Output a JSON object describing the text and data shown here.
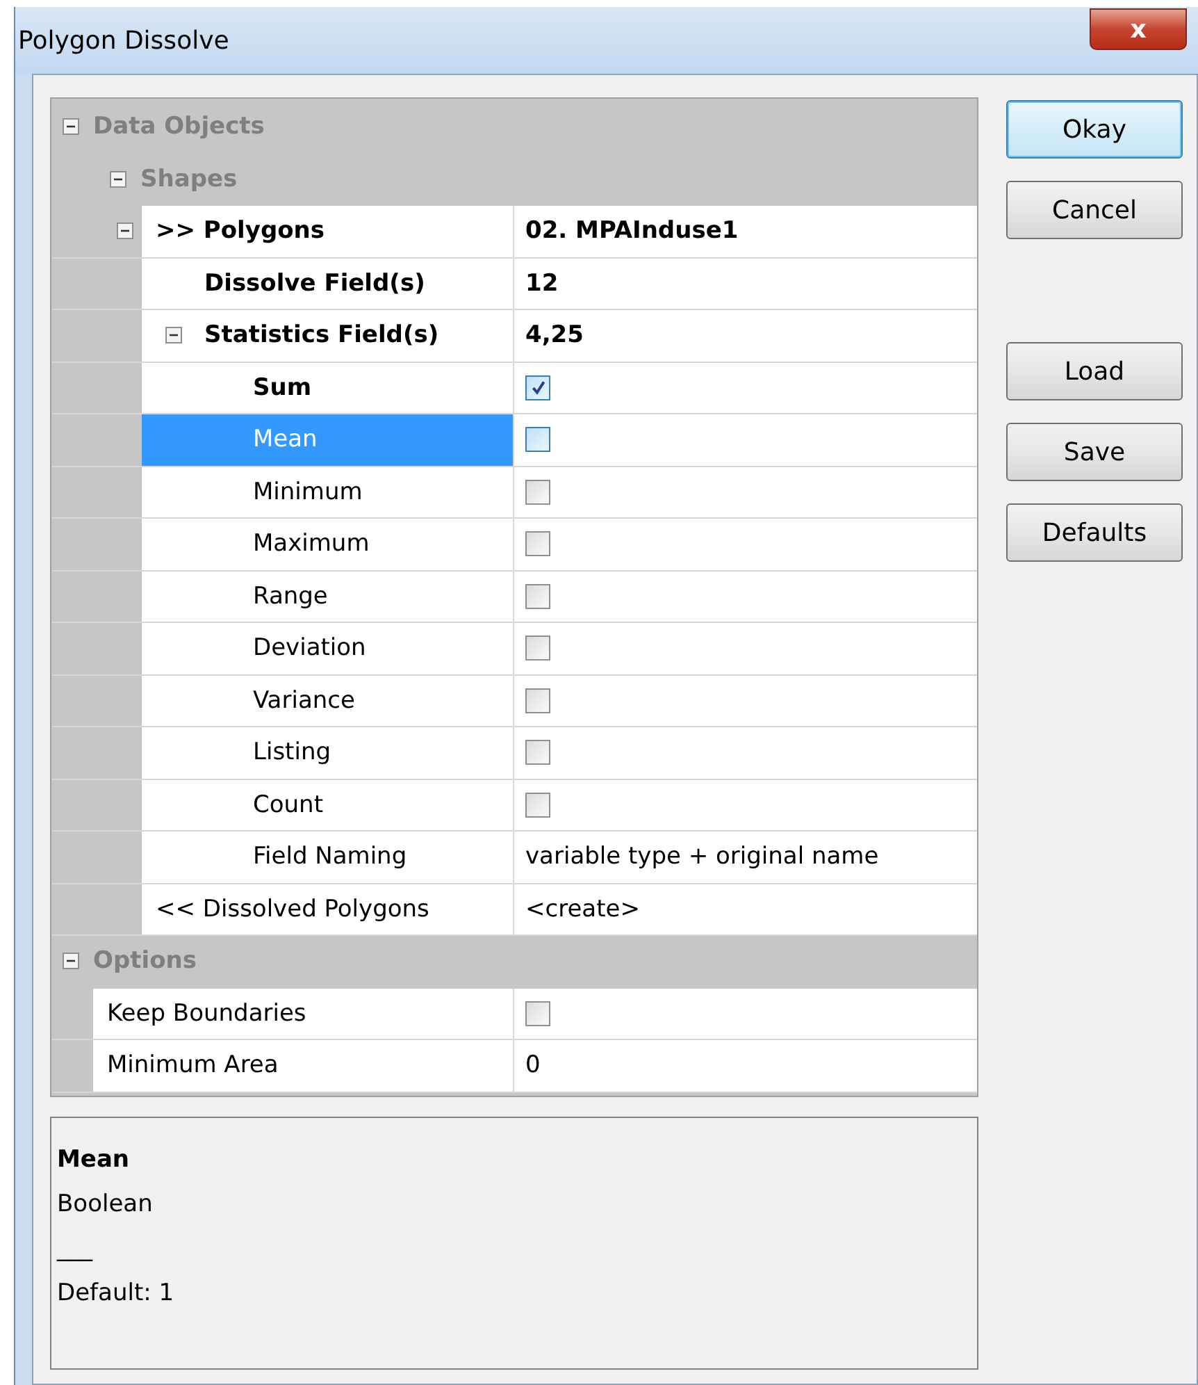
{
  "window": {
    "title": "Polygon Dissolve",
    "close_label": "x"
  },
  "grid": [
    {
      "kind": "category",
      "label": "Data Objects",
      "expanded": true,
      "children": [
        {
          "kind": "category",
          "label": "Shapes",
          "expanded": true,
          "children": [
            {
              "kind": "text",
              "label": ">> Polygons",
              "value": "02. MPAInduse1",
              "modified": true,
              "selected": false,
              "expanded": true,
              "children": [
                {
                  "kind": "text",
                  "label": "Dissolve Field(s)",
                  "value": "12",
                  "modified": true,
                  "selected": false
                },
                {
                  "kind": "text",
                  "label": "Statistics Field(s)",
                  "value": "4,25",
                  "modified": true,
                  "selected": false,
                  "expanded": true,
                  "children": [
                    {
                      "kind": "check",
                      "label": "Sum",
                      "checked": true,
                      "modified": true,
                      "selected": false
                    },
                    {
                      "kind": "check",
                      "label": "Mean",
                      "checked": false,
                      "modified": false,
                      "selected": true
                    },
                    {
                      "kind": "check",
                      "label": "Minimum",
                      "checked": false,
                      "modified": false,
                      "selected": false
                    },
                    {
                      "kind": "check",
                      "label": "Maximum",
                      "checked": false,
                      "modified": false,
                      "selected": false
                    },
                    {
                      "kind": "check",
                      "label": "Range",
                      "checked": false,
                      "modified": false,
                      "selected": false
                    },
                    {
                      "kind": "check",
                      "label": "Deviation",
                      "checked": false,
                      "modified": false,
                      "selected": false
                    },
                    {
                      "kind": "check",
                      "label": "Variance",
                      "checked": false,
                      "modified": false,
                      "selected": false
                    },
                    {
                      "kind": "check",
                      "label": "Listing",
                      "checked": false,
                      "modified": false,
                      "selected": false
                    },
                    {
                      "kind": "check",
                      "label": "Count",
                      "checked": false,
                      "modified": false,
                      "selected": false
                    },
                    {
                      "kind": "text",
                      "label": "Field Naming",
                      "value": "variable type + original name",
                      "modified": false,
                      "selected": false
                    }
                  ]
                }
              ]
            },
            {
              "kind": "text",
              "label": "<< Dissolved Polygons",
              "value": "<create>",
              "modified": false,
              "selected": false
            }
          ]
        }
      ]
    },
    {
      "kind": "category",
      "label": "Options",
      "expanded": true,
      "children": [
        {
          "kind": "check",
          "label": "Keep Boundaries",
          "checked": false,
          "modified": false,
          "selected": false
        },
        {
          "kind": "text",
          "label": "Minimum Area",
          "value": "0",
          "modified": false,
          "selected": false
        }
      ]
    }
  ],
  "description": {
    "title": "Mean",
    "lines": [
      "Boolean",
      "___",
      "Default: 1"
    ]
  },
  "buttons": [
    {
      "label": "Okay",
      "default": true
    },
    {
      "label": "Cancel",
      "default": false
    },
    {
      "label": "Load",
      "default": false
    },
    {
      "label": "Save",
      "default": false
    },
    {
      "label": "Defaults",
      "default": false
    }
  ]
}
